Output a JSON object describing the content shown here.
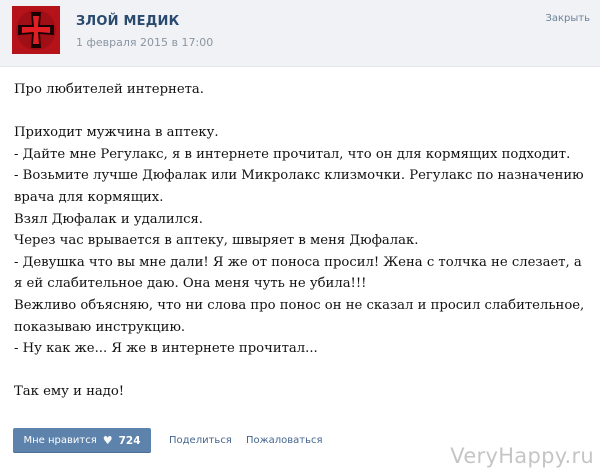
{
  "header": {
    "author": "ЗЛОЙ МЕДИК",
    "date": "1 февраля 2015 в 17:00",
    "close_label": "Закрыть",
    "avatar_icon": "red-cross-icon"
  },
  "post": {
    "lines": [
      "Про любителей интернета.",
      "",
      "Приходит мужчина в аптеку.",
      "- Дайте мне Регулакс, я в интернете прочитал, что он для кормящих подходит.",
      "- Возьмите лучше Дюфалак или Микролакс клизмочки. Регулакс по назначению врача для кормящих.",
      "Взял Дюфалак и удалился.",
      "Через час врывается в аптеку, швыряет в меня Дюфалак.",
      "- Девушка что вы мне дали! Я же от поноса просил! Жена с толчка не слезает, а я ей слабительное даю. Она меня чуть не убила!!!",
      "Вежливо объясняю, что ни слова про понос он не сказал и просил слабительное, показываю инструкцию.",
      "- Ну как же... Я же в интернете прочитал...",
      "",
      "Так ему и надо!"
    ]
  },
  "footer": {
    "like_label": "Мне нравится",
    "like_icon": "heart-icon",
    "like_count": "724",
    "share_label": "Поделиться",
    "report_label": "Пожаловаться"
  },
  "watermark": "VeryHappy.ru",
  "colors": {
    "header_bg": "#f0f2f5",
    "author": "#2a4a6f",
    "like_button": "#5d83ac",
    "link": "#44658e"
  }
}
